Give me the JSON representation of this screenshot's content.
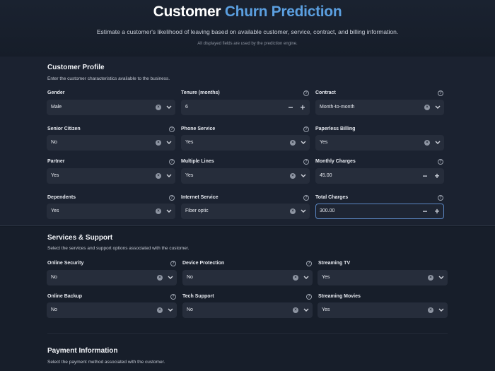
{
  "header": {
    "title_part1": "Customer",
    "title_part2": "Churn Prediction",
    "subtitle": "Estimate a customer's likelihood of leaving based on available customer, service, contract, and billing information.",
    "note": "All displayed fields are used by the prediction engine."
  },
  "profile": {
    "title": "Customer Profile",
    "description": "Enter the customer characteristics available to the business.",
    "gender": {
      "label": "Gender",
      "value": "Male"
    },
    "tenure": {
      "label": "Tenure (months)",
      "value": "6"
    },
    "contract": {
      "label": "Contract",
      "value": "Month-to-month"
    },
    "senior": {
      "label": "Senior Citizen",
      "value": "No"
    },
    "phone": {
      "label": "Phone Service",
      "value": "Yes"
    },
    "paperless": {
      "label": "Paperless Billing",
      "value": "Yes"
    },
    "partner": {
      "label": "Partner",
      "value": "Yes"
    },
    "multiple": {
      "label": "Multiple Lines",
      "value": "Yes"
    },
    "monthly": {
      "label": "Monthly Charges",
      "value": "45.00"
    },
    "dependents": {
      "label": "Dependents",
      "value": "Yes"
    },
    "internet": {
      "label": "Internet Service",
      "value": "Fiber optic"
    },
    "total": {
      "label": "Total Charges",
      "value": "300.00"
    }
  },
  "services": {
    "title": "Services & Support",
    "description": "Select the services and support options associated with the customer.",
    "security": {
      "label": "Online Security",
      "value": "No"
    },
    "device": {
      "label": "Device Protection",
      "value": "No"
    },
    "tv": {
      "label": "Streaming TV",
      "value": "Yes"
    },
    "backup": {
      "label": "Online Backup",
      "value": "No"
    },
    "tech": {
      "label": "Tech Support",
      "value": "No"
    },
    "movies": {
      "label": "Streaming Movies",
      "value": "Yes"
    }
  },
  "payment": {
    "title": "Payment Information",
    "description": "Select the payment method associated with the customer."
  },
  "icons": {
    "help": "?",
    "clear": "×",
    "minus": "−",
    "plus": "+"
  },
  "colors": {
    "accent": "#5b9fe0",
    "background": "#141b26",
    "input": "#262d3b",
    "focus": "#5b86c2"
  }
}
